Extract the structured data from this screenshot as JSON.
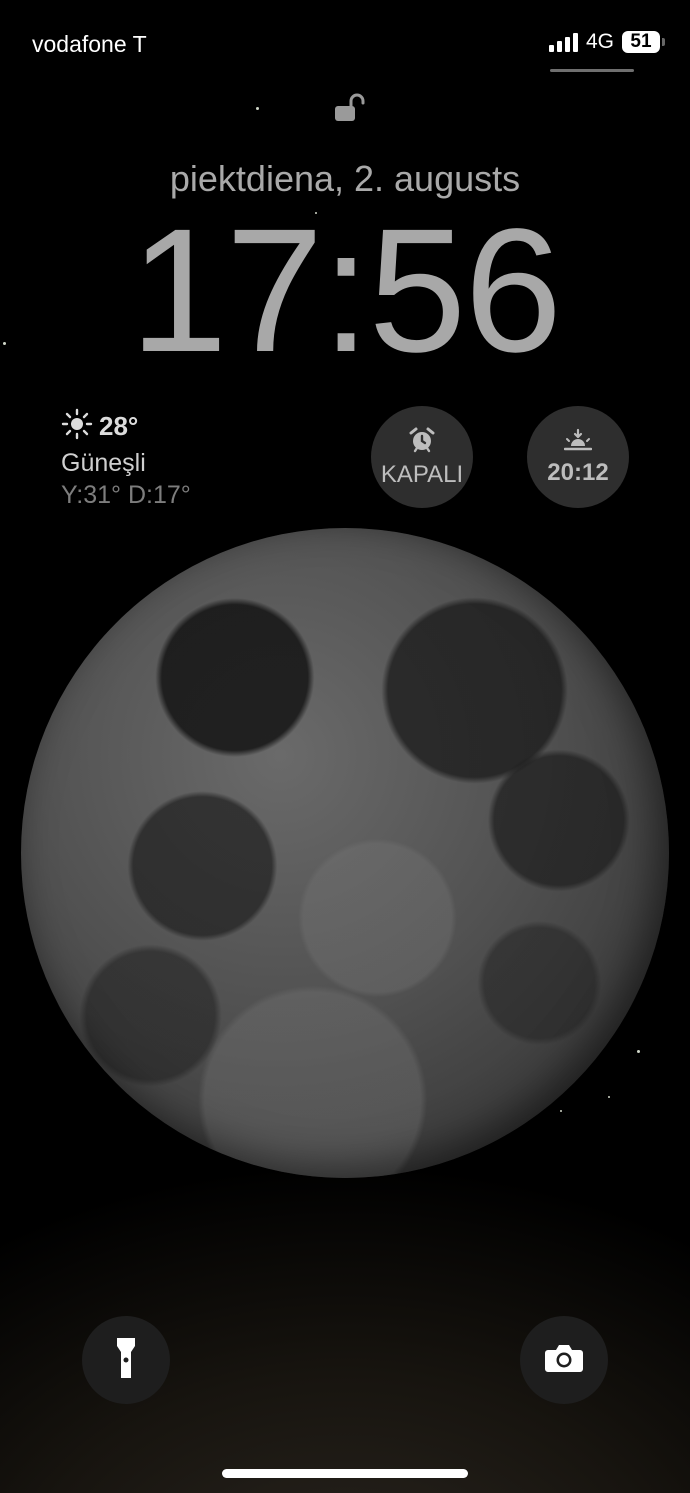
{
  "status_bar": {
    "carrier": "vodafone T",
    "network": "4G",
    "battery": "51"
  },
  "lock_screen": {
    "date": "piektdiena, 2. augusts",
    "time": "17:56"
  },
  "weather_widget": {
    "icon": "sun-icon",
    "temperature": "28°",
    "condition": "Güneşli",
    "range": "Y:31° D:17°"
  },
  "alarm_widget": {
    "icon": "alarm-clock-icon",
    "label": "KAPALI"
  },
  "sunset_widget": {
    "icon": "sunset-icon",
    "label": "20:12"
  },
  "quick_actions": {
    "flashlight_icon": "flashlight-icon",
    "camera_icon": "camera-icon"
  }
}
